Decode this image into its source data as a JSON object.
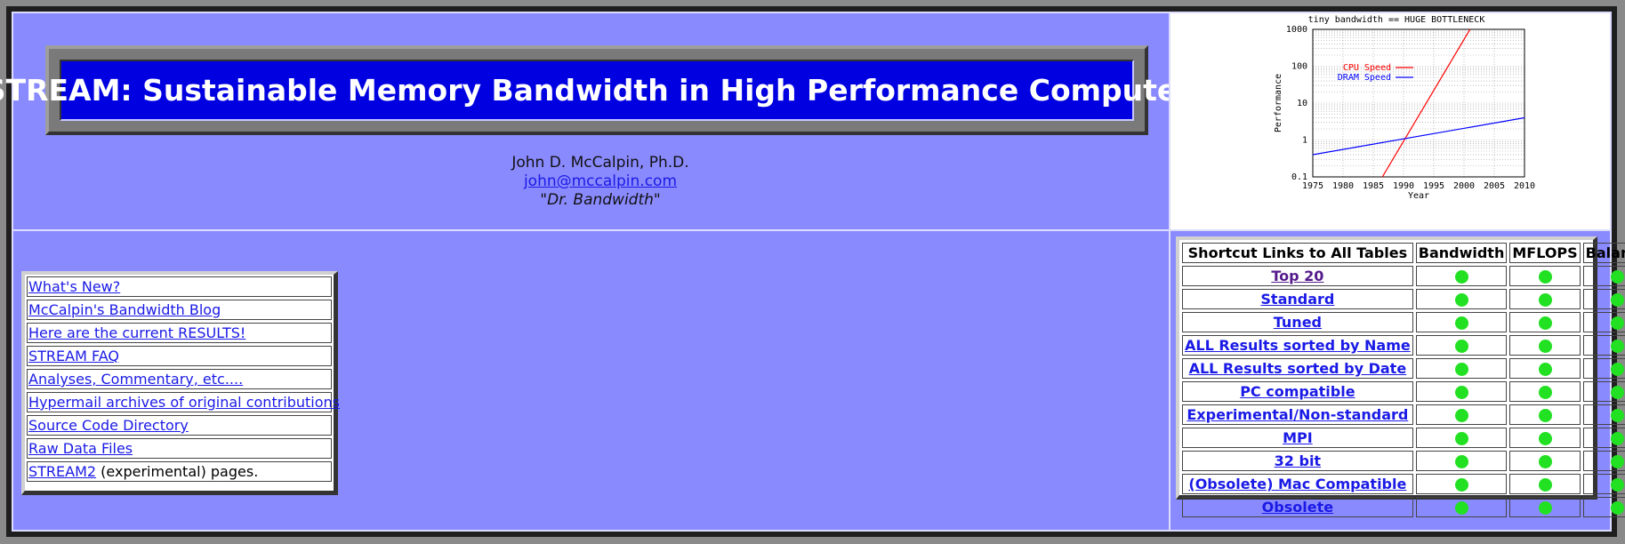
{
  "header": {
    "title": "STREAM: Sustainable Memory Bandwidth in High Performance Computers",
    "author_name": "John D. McCalpin, Ph.D.",
    "author_email": "john@mccalpin.com",
    "author_nickname": "\"Dr. Bandwidth\""
  },
  "links": [
    {
      "text": "What's New?"
    },
    {
      "text": "McCalpin's Bandwidth Blog"
    },
    {
      "text": "Here are the current RESULTS!"
    },
    {
      "text": "STREAM FAQ"
    },
    {
      "text": "Analyses, Commentary, etc...."
    },
    {
      "text": "Hypermail archives of original contributions"
    },
    {
      "text": "Source Code Directory"
    },
    {
      "text": "Raw Data Files"
    },
    {
      "text": "STREAM2",
      "suffix": " (experimental) pages."
    }
  ],
  "shortcut_table": {
    "headers": [
      "Shortcut Links to All Tables",
      "Bandwidth",
      "MFLOPS",
      "Balance"
    ],
    "rows": [
      "Top 20",
      "Standard",
      "Tuned",
      "ALL Results sorted by Name",
      "ALL Results sorted by Date",
      "PC compatible",
      "Experimental/Non-standard",
      "MPI",
      "32 bit",
      "(Obsolete) Mac Compatible",
      "Obsolete"
    ],
    "indicator_color": "#22e022"
  },
  "chart_data": {
    "type": "line",
    "title": "tiny bandwidth == HUGE BOTTLENECK",
    "xlabel": "Year",
    "ylabel": "Performance",
    "y_scale": "log",
    "xlim": [
      1975,
      2010
    ],
    "ylim": [
      0.1,
      1000
    ],
    "x_ticks": [
      "1975",
      "1980",
      "1985",
      "1990",
      "1995",
      "2000",
      "2005",
      "2010"
    ],
    "y_ticks": [
      "0.1",
      "1",
      "10",
      "100",
      "1000"
    ],
    "grid": true,
    "legend_position": "top-left",
    "series": [
      {
        "name": "CPU Speed",
        "color": "#ff0000",
        "x": [
          1986.5,
          2001
        ],
        "y": [
          0.1,
          1000
        ]
      },
      {
        "name": "DRAM Speed",
        "color": "#0000ff",
        "x": [
          1975,
          2010
        ],
        "y": [
          0.4,
          4
        ]
      }
    ]
  }
}
